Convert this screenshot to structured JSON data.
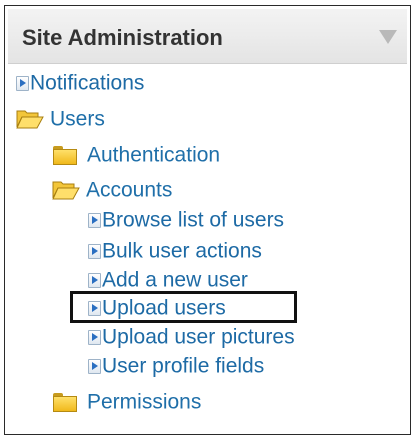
{
  "block": {
    "title": "Site Administration",
    "collapse_icon": "triangle-down-icon"
  },
  "tree": {
    "notifications": "Notifications",
    "users": "Users",
    "authentication": "Authentication",
    "accounts": "Accounts",
    "browse_list_of_users": "Browse list of users",
    "bulk_user_actions": "Bulk user actions",
    "add_a_new_user": "Add a new user",
    "upload_users": "Upload users",
    "upload_user_pictures": "Upload user pictures",
    "user_profile_fields": "User profile fields",
    "permissions": "Permissions"
  },
  "highlighted_item": "Upload users",
  "colors": {
    "link": "#1d6aa5",
    "header_text": "#333333",
    "folder": "#f0b91c",
    "highlight_border": "#111111"
  }
}
